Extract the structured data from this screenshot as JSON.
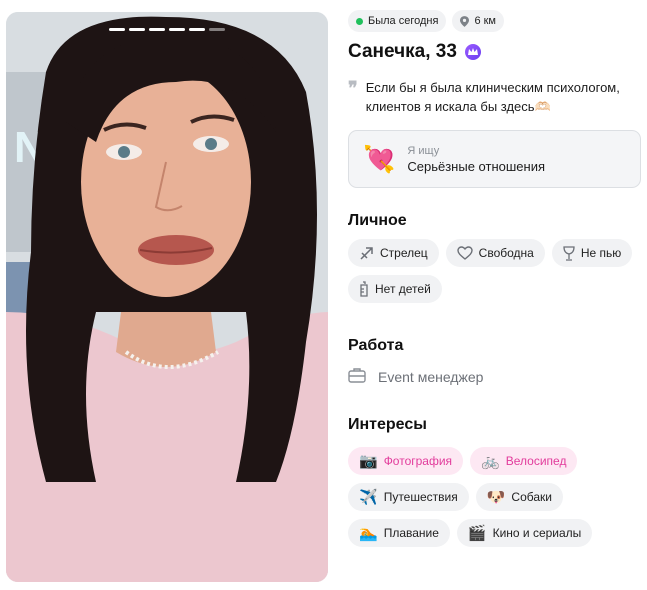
{
  "status": {
    "online": "Была сегодня",
    "distance": "6 км"
  },
  "profile": {
    "name_age": "Санечка, 33",
    "about": "Если бы я была клиническим психологом, клиентов я искала бы здесь🫶🏻"
  },
  "looking_for": {
    "label": "Я ищу",
    "value": "Серьёзные отношения",
    "icon": "heart-arrow-icon"
  },
  "personal": {
    "title": "Личное",
    "chips": [
      {
        "label": "Стрелец",
        "icon": "sagittarius-icon"
      },
      {
        "label": "Свободна",
        "icon": "heart-outline-icon"
      },
      {
        "label": "Не пью",
        "icon": "wine-glass-icon"
      },
      {
        "label": "Нет детей",
        "icon": "baby-bottle-icon"
      }
    ]
  },
  "work": {
    "title": "Работа",
    "value": "Event менеджер",
    "icon": "briefcase-icon"
  },
  "interests": {
    "title": "Интересы",
    "chips": [
      {
        "label": "Фотография",
        "emoji": "📷",
        "highlight": true
      },
      {
        "label": "Велосипед",
        "emoji": "🚲",
        "highlight": true
      },
      {
        "label": "Путешествия",
        "emoji": "✈️",
        "highlight": false
      },
      {
        "label": "Собаки",
        "emoji": "🐶",
        "highlight": false
      },
      {
        "label": "Плавание",
        "emoji": "🏊",
        "highlight": false
      },
      {
        "label": "Кино и сериалы",
        "emoji": "🎬",
        "highlight": false
      }
    ]
  },
  "photo": {
    "count": 6,
    "current": 5
  },
  "colors": {
    "online": "#20c05c",
    "premium": "#7a45f5",
    "interest_highlight_bg": "#fde8f3",
    "interest_highlight_text": "#e23c9c"
  }
}
